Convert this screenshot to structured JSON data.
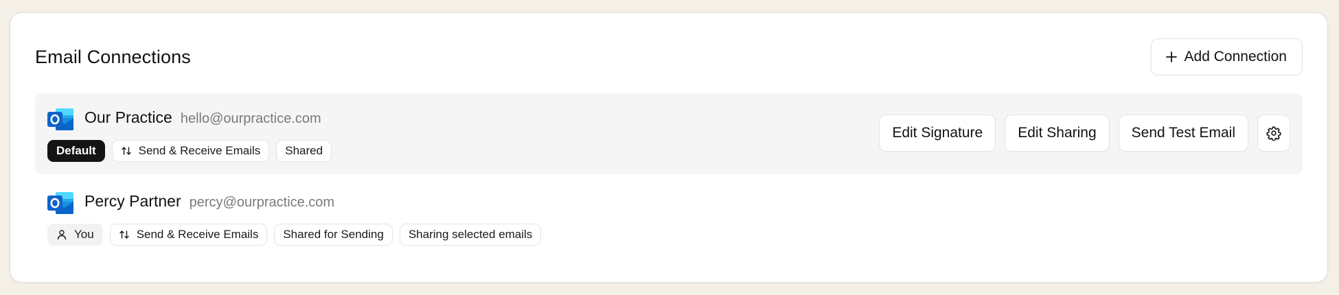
{
  "header": {
    "title": "Email Connections",
    "add_connection_label": "Add Connection",
    "add_icon": "plus-icon"
  },
  "colors": {
    "page_background": "#f4f0e8",
    "card_background": "#ffffff",
    "selected_row_background": "#f5f5f5",
    "default_badge": "#141414",
    "email_text": "#7a7a7a",
    "outlook_blue": "#0a64c8"
  },
  "connections": [
    {
      "name": "Our Practice",
      "email": "hello@ourpractice.com",
      "provider_icon": "outlook-icon",
      "selected": true,
      "tags": [
        {
          "label": "Default",
          "style": "dark",
          "icon": ""
        },
        {
          "label": "Send & Receive Emails",
          "style": "outline",
          "icon": "sort-arrows-icon"
        },
        {
          "label": "Shared",
          "style": "outline",
          "icon": ""
        }
      ],
      "actions": {
        "edit_signature": "Edit Signature",
        "edit_sharing": "Edit Sharing",
        "send_test_email": "Send Test Email",
        "settings_icon": "gear-icon"
      }
    },
    {
      "name": "Percy Partner",
      "email": "percy@ourpractice.com",
      "provider_icon": "outlook-icon",
      "selected": false,
      "tags": [
        {
          "label": "You",
          "style": "soft",
          "icon": "user-icon"
        },
        {
          "label": "Send & Receive Emails",
          "style": "outline",
          "icon": "sort-arrows-icon"
        },
        {
          "label": "Shared for Sending",
          "style": "outline",
          "icon": ""
        },
        {
          "label": "Sharing selected emails",
          "style": "outline",
          "icon": ""
        }
      ]
    }
  ]
}
